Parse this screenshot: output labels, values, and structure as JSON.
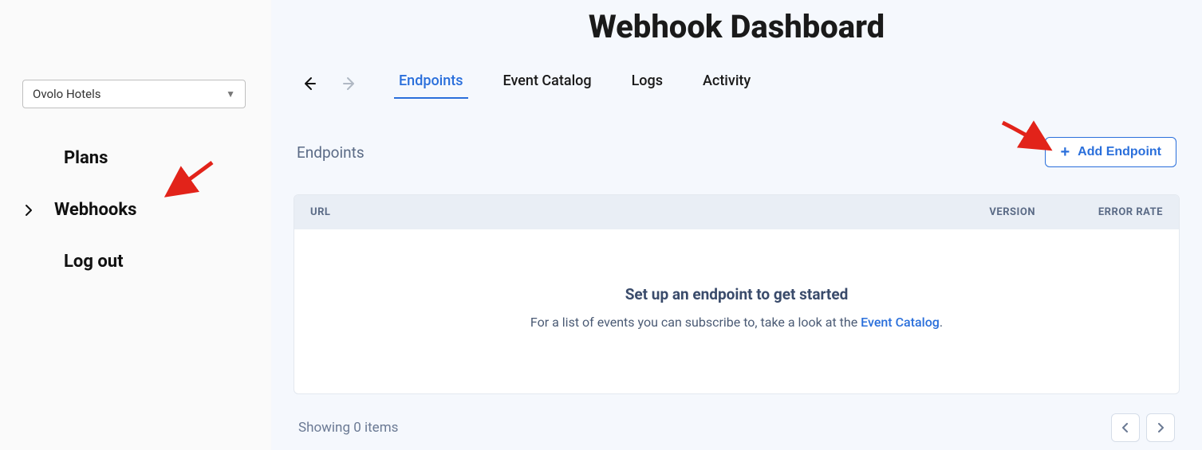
{
  "sidebar": {
    "selector_value": "Ovolo Hotels",
    "items": [
      {
        "label": "Plans",
        "has_chevron": false
      },
      {
        "label": "Webhooks",
        "has_chevron": true
      },
      {
        "label": "Log out",
        "has_chevron": false
      }
    ]
  },
  "page": {
    "title": "Webhook Dashboard"
  },
  "tabs": [
    {
      "label": "Endpoints",
      "active": true
    },
    {
      "label": "Event Catalog",
      "active": false
    },
    {
      "label": "Logs",
      "active": false
    },
    {
      "label": "Activity",
      "active": false
    }
  ],
  "section": {
    "title": "Endpoints",
    "add_button": "Add Endpoint"
  },
  "table": {
    "columns": {
      "url": "URL",
      "version": "VERSION",
      "error_rate": "ERROR RATE"
    },
    "empty_title": "Set up an endpoint to get started",
    "empty_desc_pre": "For a list of events you can subscribe to, take a look at the ",
    "empty_link": "Event Catalog",
    "empty_desc_post": "."
  },
  "pager": {
    "label": "Showing 0 items"
  }
}
